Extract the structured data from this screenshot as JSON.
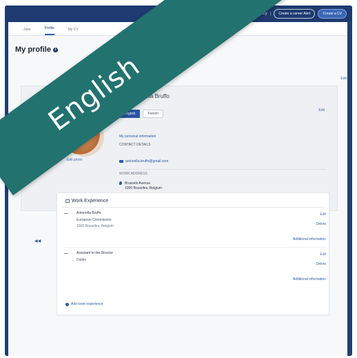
{
  "topbar": {
    "find_label": "Find a vacancy",
    "separator": "|",
    "create_job_alert_label": "Create a career Alert",
    "create_cv_label": "Create a CV"
  },
  "tabs": [
    {
      "label": "Jobs"
    },
    {
      "label": "Profile"
    },
    {
      "label": "My CV"
    }
  ],
  "page": {
    "title": "My profile",
    "info_icon": "i"
  },
  "profile": {
    "name": "Antonella Bruffo",
    "languages": [
      "English",
      "French"
    ],
    "edit_top": "Edit",
    "edit_right": "Edit",
    "edit_photo": "Edit photo",
    "personal_info_link": "My personal information",
    "contact_label": "CONTACT DETAILS",
    "email": "antonella.bruffo@gmail.com",
    "work_label": "WORK ADDRESS",
    "address_line1": "Brussels Avenue",
    "address_line2": "1000 Bruxelles, Belgium"
  },
  "experience": {
    "heading": "Work Experience",
    "items": [
      {
        "role": "Antonella Bruffo",
        "company": "European Commission",
        "location": "1000 Bruxelles, Belgium",
        "edit": "Edit",
        "delete": "Delete",
        "more": "Additional information"
      },
      {
        "role": "Assistant to the Director",
        "company": "Dublin",
        "location": "",
        "edit": "Edit",
        "delete": "Delete",
        "more": "Additional information"
      }
    ],
    "add_label": "Add work experience"
  },
  "ribbon": {
    "label": "English",
    "color": "#22726f"
  },
  "colors": {
    "brand_navy": "#1e3a70",
    "accent_blue": "#2b5aa8"
  }
}
